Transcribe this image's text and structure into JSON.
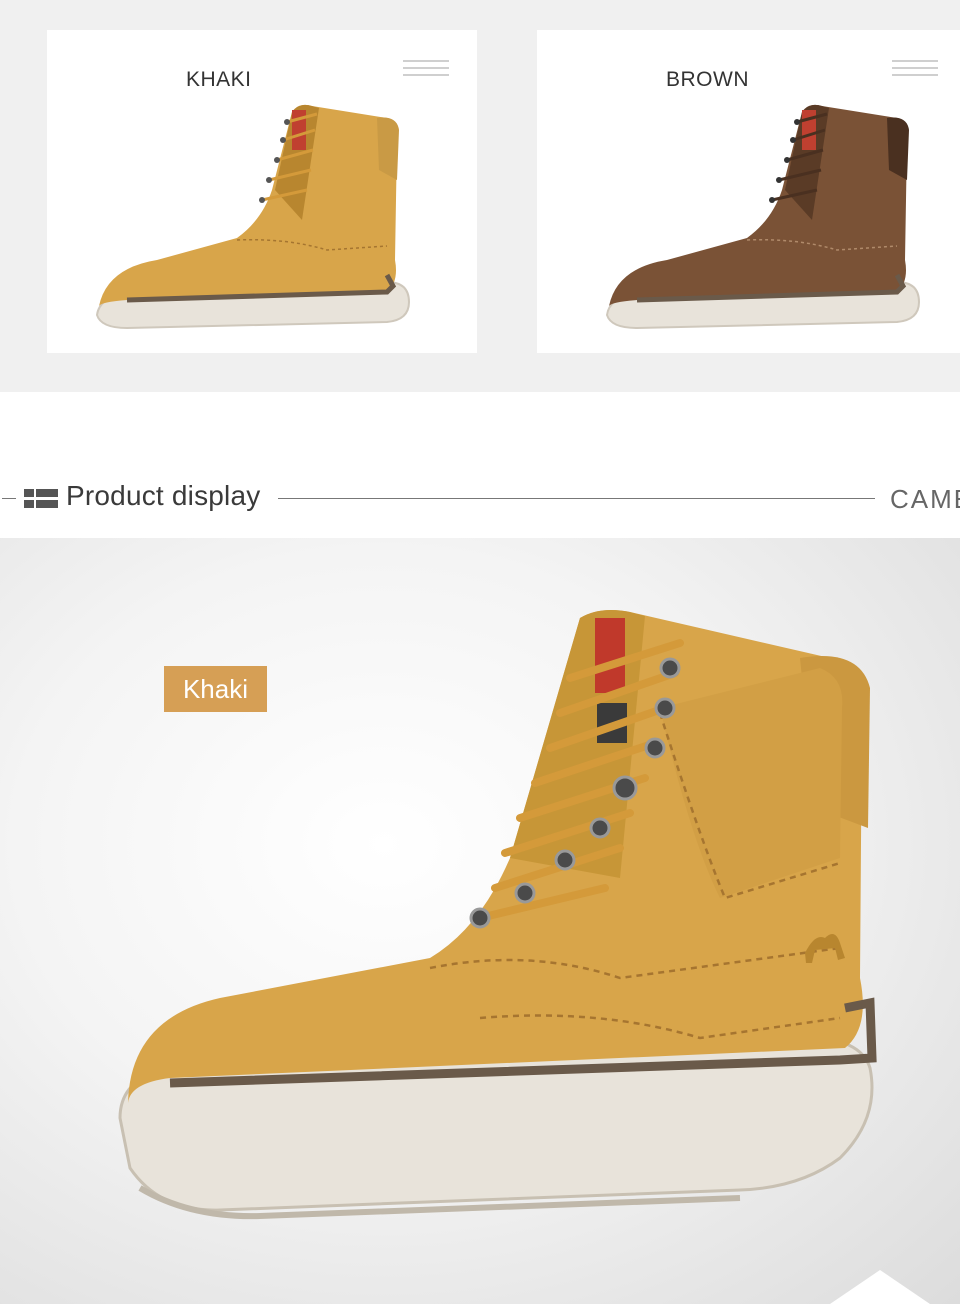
{
  "variants": [
    {
      "label": "KHAKI",
      "upper": "#d8a54a",
      "shade": "#b8862f",
      "collar": "#c99a45"
    },
    {
      "label": "BROWN",
      "upper": "#7a5236",
      "shade": "#5a3b26",
      "collar": "#4a3020"
    }
  ],
  "section": {
    "title": "Product display",
    "brand": "CAMEL"
  },
  "display": {
    "tag": "Khaki"
  },
  "colors": {
    "tag_bg": "#d69f55",
    "sole": "#e8e3da",
    "sole_dark": "#6a5a4a",
    "lace": "#d49a3a"
  },
  "icons": [
    "menu-lines-icon",
    "grid-list-icon"
  ]
}
